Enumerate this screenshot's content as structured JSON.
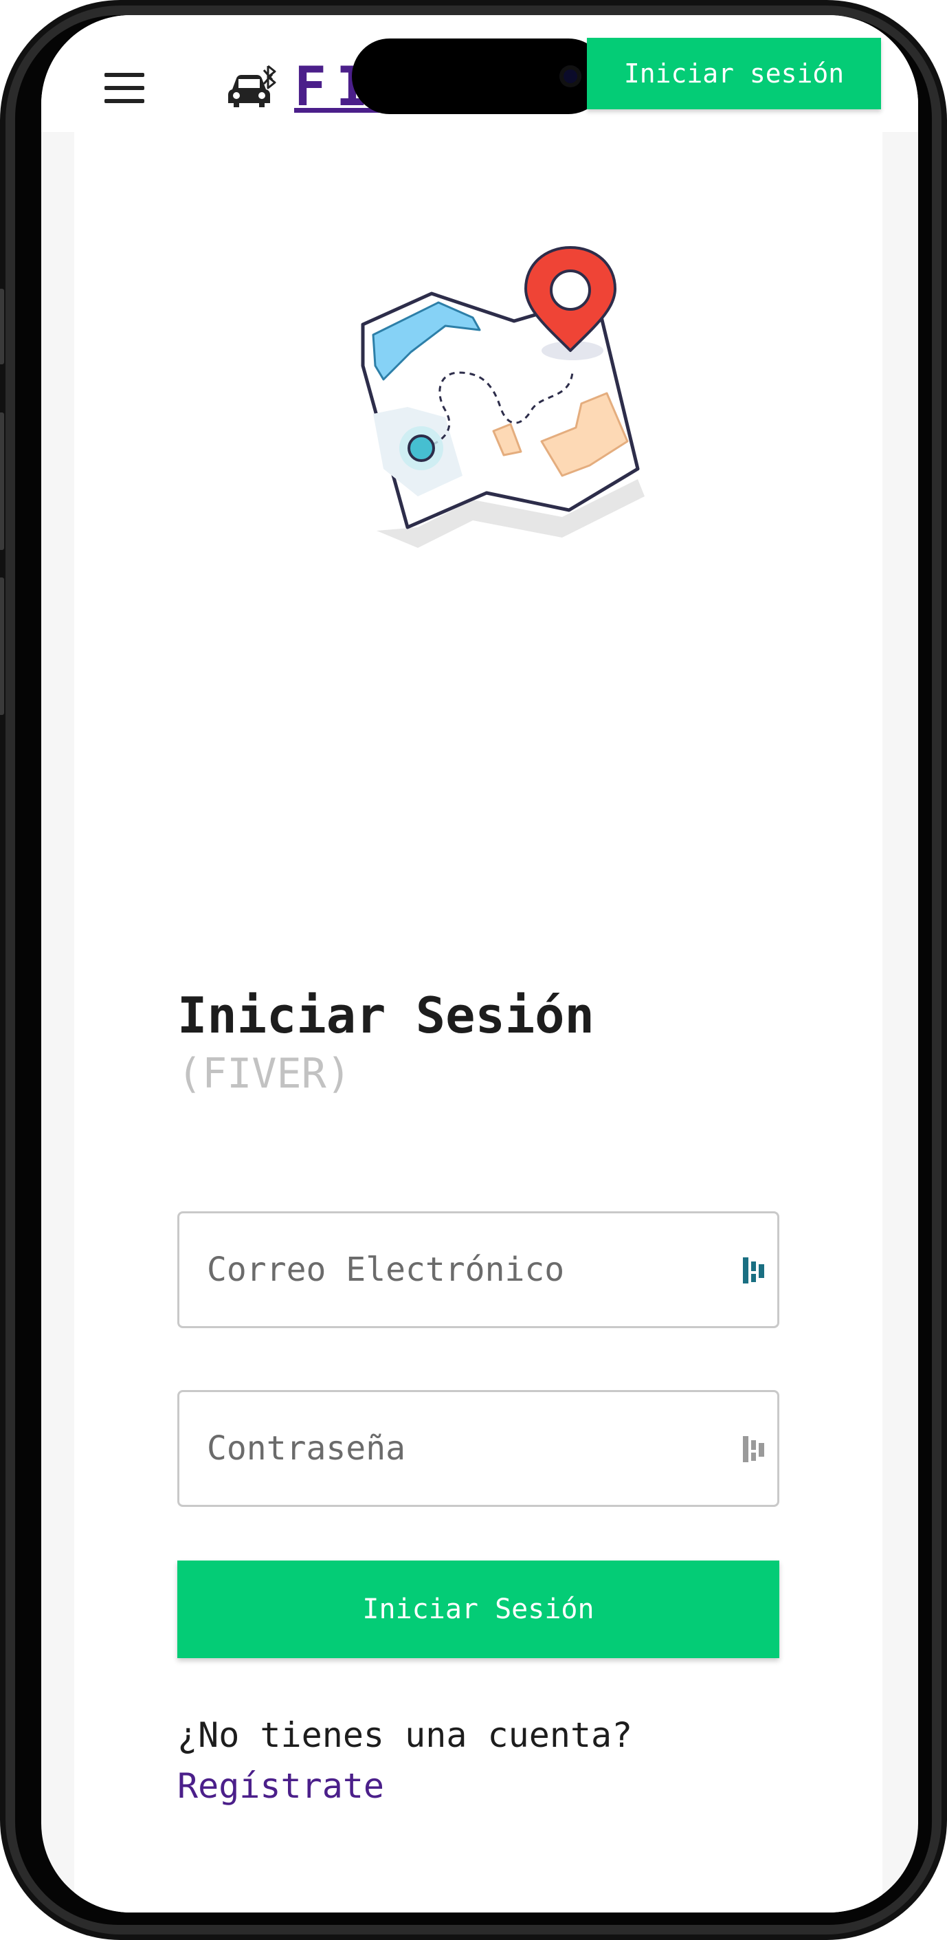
{
  "header": {
    "brand_name": "FIVER",
    "login_button": "Iniciar sesión"
  },
  "login": {
    "title": "Iniciar Sesión",
    "subtitle": "(FIVER)",
    "email_placeholder": "Correo Electrónico",
    "password_placeholder": "Contraseña",
    "submit_label": "Iniciar Sesión",
    "no_account_text": "¿No tienes una cuenta?",
    "register_link": "Regístrate"
  },
  "icons": {
    "menu": "hamburger-menu-icon",
    "brand": "car-bluetooth-icon",
    "illustration": "map-with-location-pin",
    "email_field_icon": "password-manager-icon",
    "password_field_icon": "password-manager-icon"
  },
  "colors": {
    "accent_green": "#04cc76",
    "brand_purple": "#4b1f8a",
    "subtitle_gray": "#c2c2c2"
  }
}
